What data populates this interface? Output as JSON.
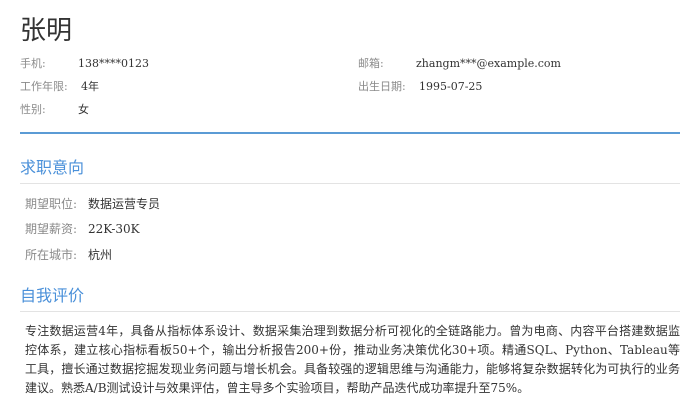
{
  "header": {
    "name": "张明"
  },
  "basic_info": {
    "phone": {
      "label": "手机:",
      "value": "138****0123"
    },
    "email": {
      "label": "邮箱:",
      "value": "zhangm***@example.com"
    },
    "experience": {
      "label": "工作年限:",
      "value": "4年"
    },
    "birthdate": {
      "label": "出生日期:",
      "value": "1995-07-25"
    },
    "gender": {
      "label": "性别:",
      "value": "女"
    }
  },
  "job_intent": {
    "title": "求职意向",
    "position": {
      "label": "期望职位:",
      "value": "数据运营专员"
    },
    "salary": {
      "label": "期望薪资:",
      "value": "22K-30K"
    },
    "city": {
      "label": "所在城市:",
      "value": "杭州"
    }
  },
  "self_evaluation": {
    "title": "自我评价",
    "text": "专注数据运营4年，具备从指标体系设计、数据采集治理到数据分析可视化的全链路能力。曾为电商、内容平台搭建数据监控体系，建立核心指标看板50+个，输出分析报告200+份，推动业务决策优化30+项。精通SQL、Python、Tableau等工具，擅长通过数据挖掘发现业务问题与增长机会。具备较强的逻辑思维与沟通能力，能够将复杂数据转化为可执行的业务建议。熟悉A/B测试设计与效果评估，曾主导多个实验项目，帮助产品迭代成功率提升至75%。"
  },
  "colors": {
    "accent": "#4a90d9",
    "divider": "#5b9bd5",
    "label": "#8a8a8a",
    "text": "#333333"
  }
}
